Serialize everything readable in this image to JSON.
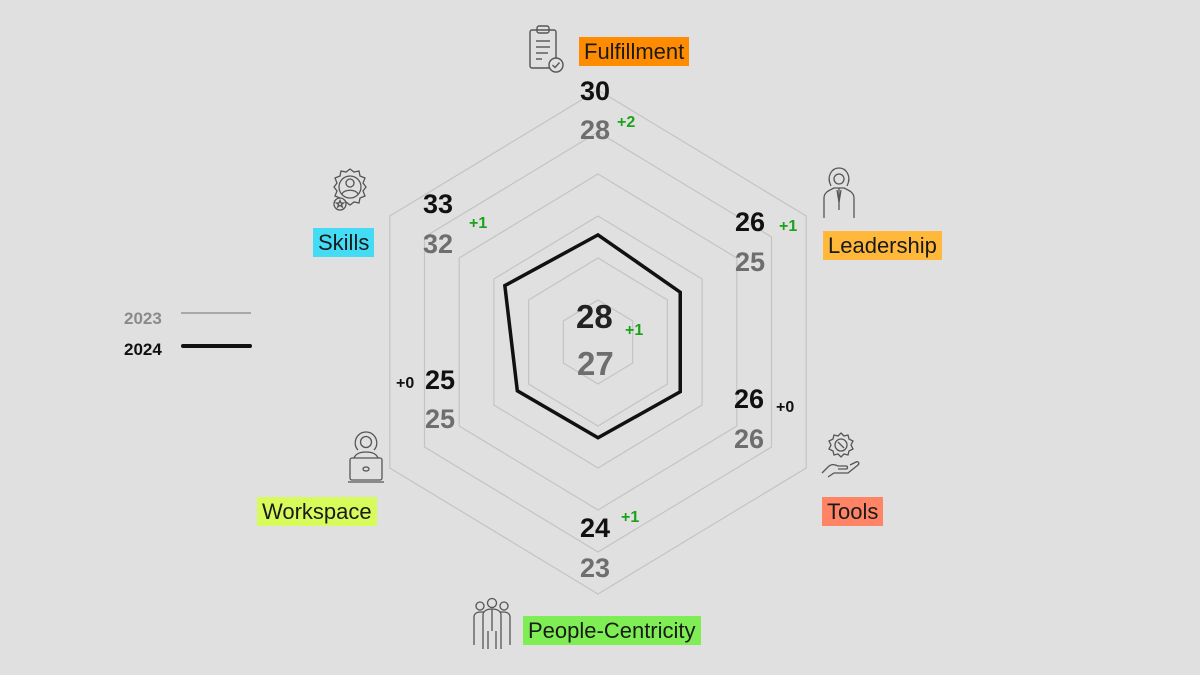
{
  "chart_data": {
    "type": "radar",
    "title": "",
    "axes": [
      "Fulfillment",
      "Leadership",
      "Tools",
      "People-Centricity",
      "Workspace",
      "Skills"
    ],
    "series": [
      {
        "name": "2023",
        "values": [
          28,
          25,
          26,
          23,
          25,
          32
        ],
        "color": "#a0a0a0"
      },
      {
        "name": "2024",
        "values": [
          30,
          26,
          26,
          24,
          25,
          33
        ],
        "color": "#111111"
      }
    ],
    "deltas": [
      "+2",
      "+1",
      "+0",
      "+1",
      "+0",
      "+1"
    ],
    "overall": {
      "2024": 28,
      "2023": 27,
      "delta": "+1"
    },
    "legend": {
      "position": "left",
      "entries": [
        "2023",
        "2024"
      ]
    },
    "grid": true,
    "grid_rings": 6
  },
  "axes_meta": [
    {
      "label": "Fulfillment",
      "badge_color": "#ff8c00",
      "icon": "clipboard-check-icon",
      "v24": "30",
      "v23": "28",
      "delta": "+2",
      "delta_type": "pos"
    },
    {
      "label": "Leadership",
      "badge_color": "#ffb83a",
      "icon": "leader-person-icon",
      "v24": "26",
      "v23": "25",
      "delta": "+1",
      "delta_type": "pos"
    },
    {
      "label": "Tools",
      "badge_color": "#ff8466",
      "icon": "gear-hand-icon",
      "v24": "26",
      "v23": "26",
      "delta": "+0",
      "delta_type": "zero"
    },
    {
      "label": "People-Centricity",
      "badge_color": "#7fee55",
      "icon": "people-group-icon",
      "v24": "24",
      "v23": "23",
      "delta": "+1",
      "delta_type": "pos"
    },
    {
      "label": "Workspace",
      "badge_color": "#d8fb5c",
      "icon": "person-laptop-icon",
      "v24": "25",
      "v23": "25",
      "delta": "+0",
      "delta_type": "zero"
    },
    {
      "label": "Skills",
      "badge_color": "#44dcf5",
      "icon": "gear-person-icon",
      "v24": "33",
      "v23": "32",
      "delta": "+1",
      "delta_type": "pos"
    }
  ],
  "center": {
    "v24": "28",
    "v23": "27",
    "delta": "+1"
  },
  "legend": {
    "items": [
      {
        "label": "2023",
        "color": "#8a8a8a"
      },
      {
        "label": "2024",
        "color": "#111111"
      }
    ]
  }
}
